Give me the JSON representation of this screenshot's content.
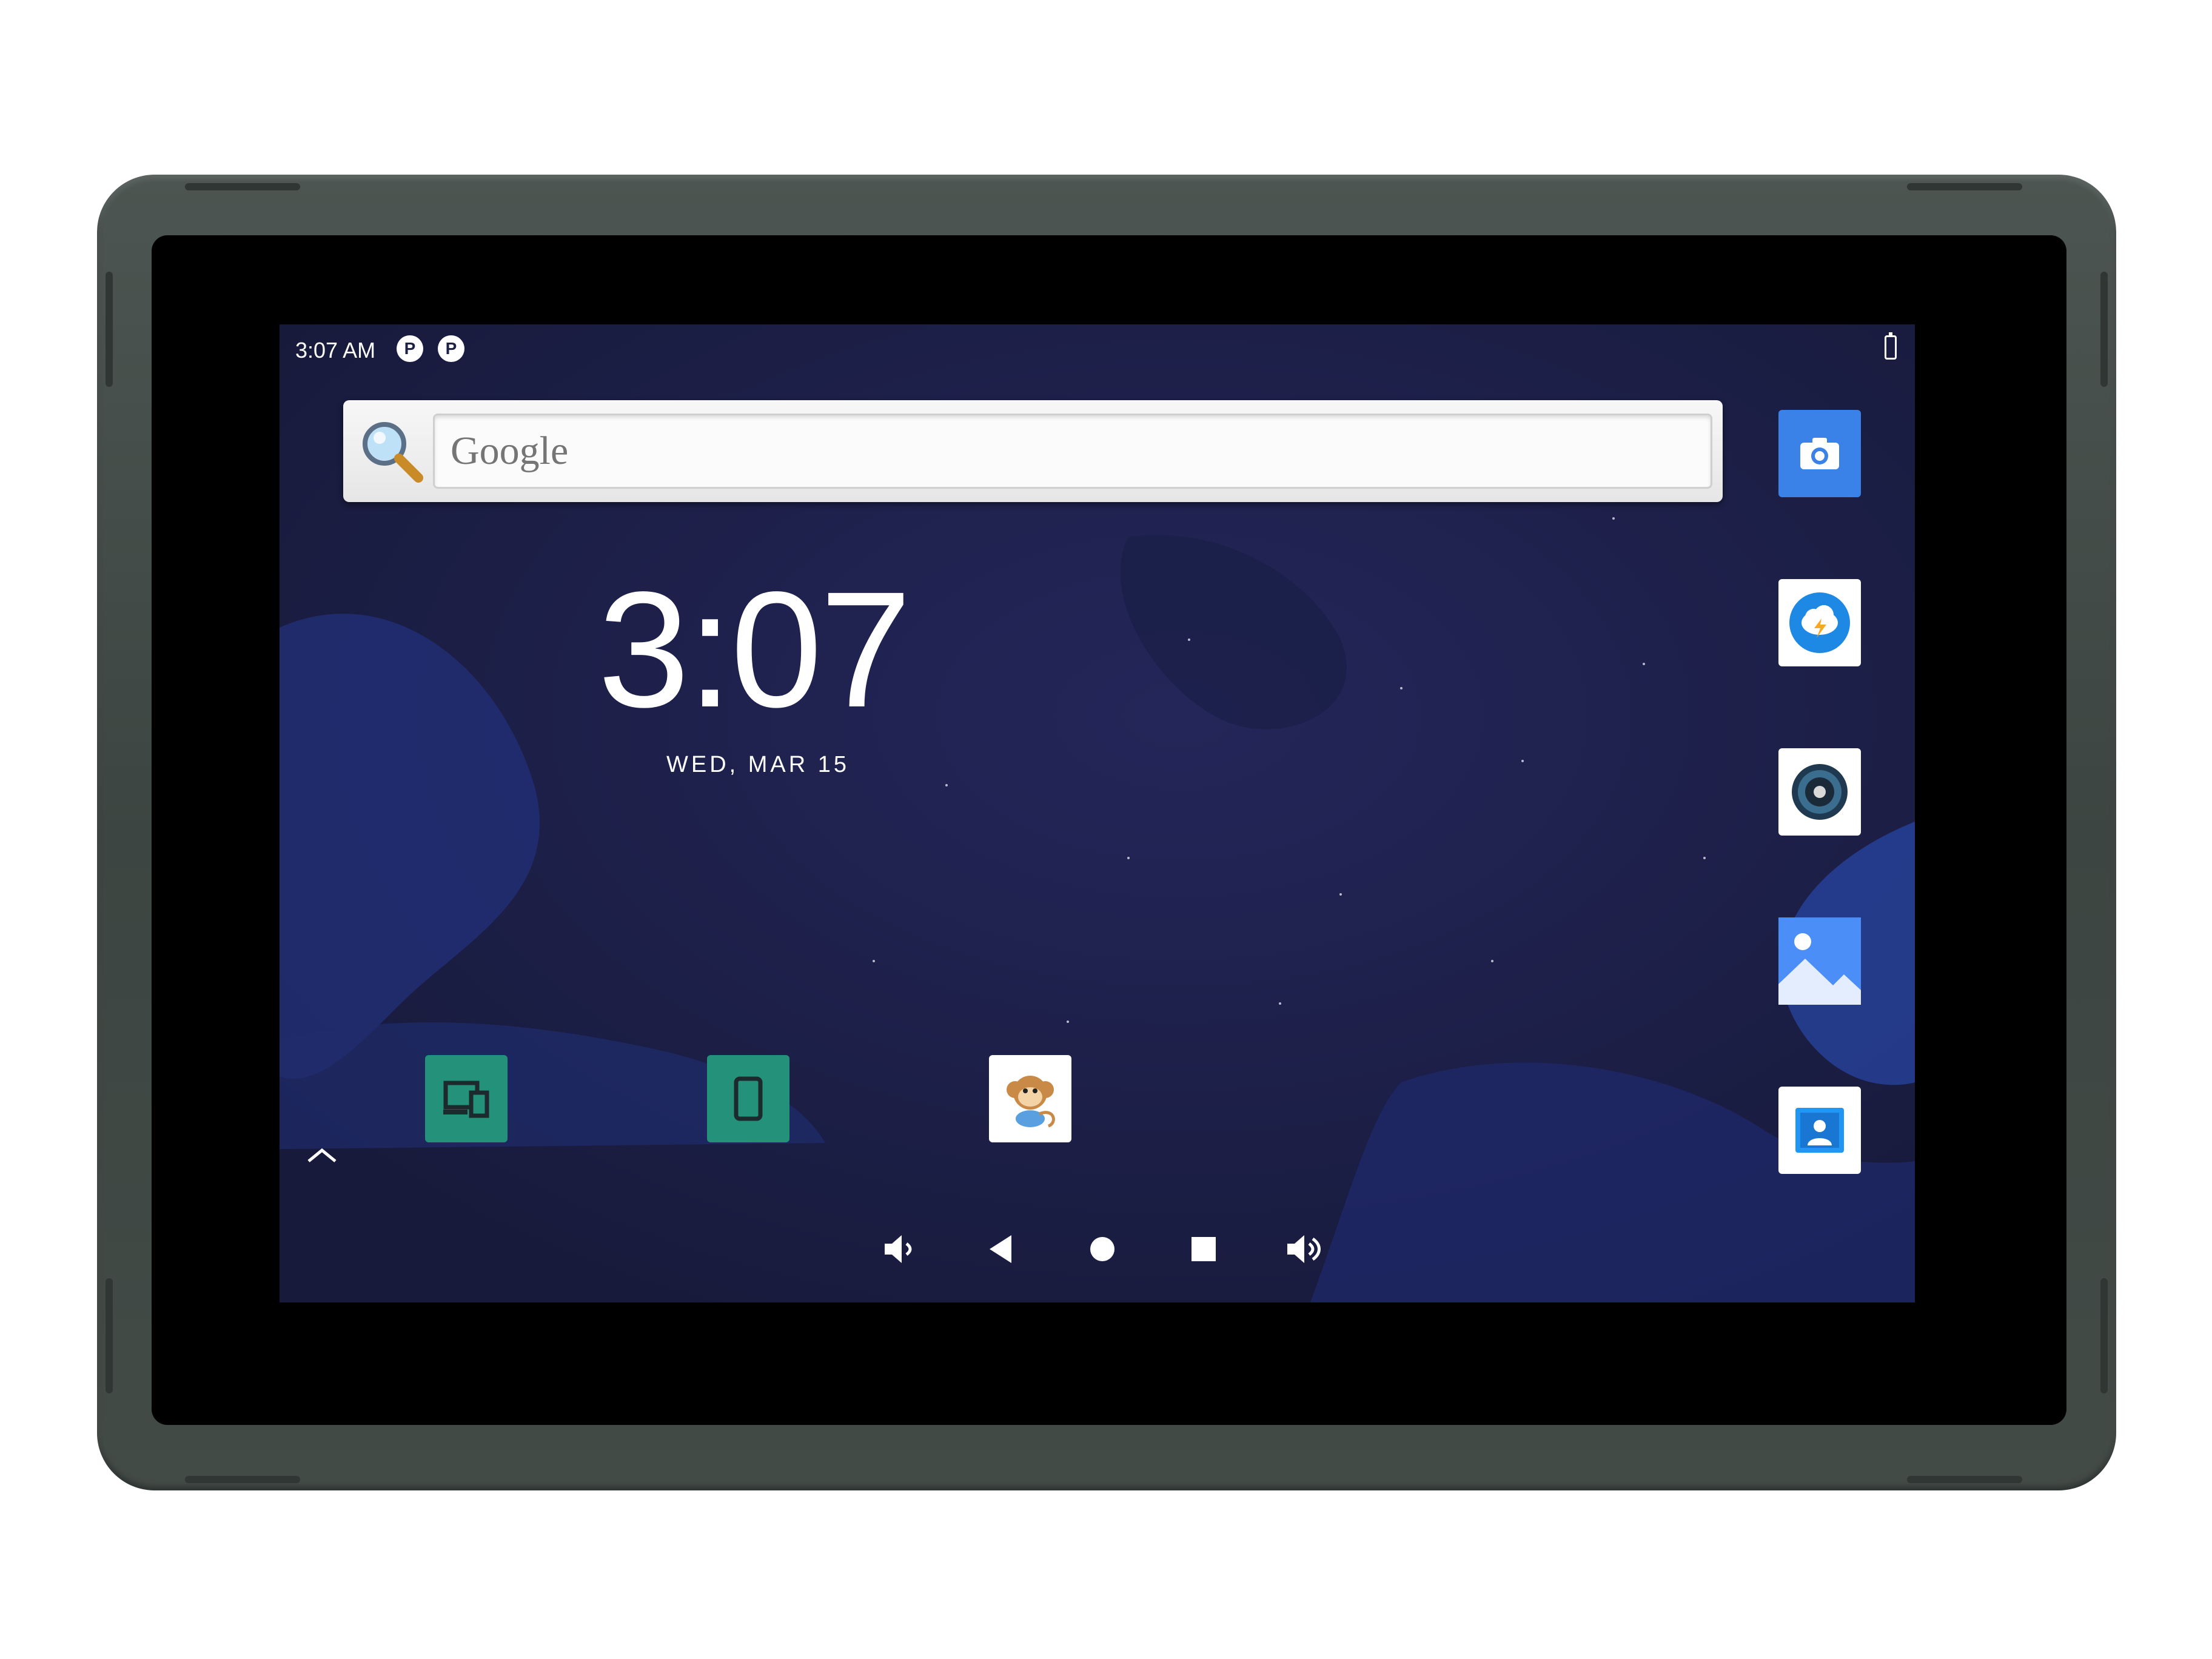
{
  "status_bar": {
    "time": "3:07 AM",
    "notification_icons": [
      "notification-icon",
      "notification-icon"
    ],
    "notification_glyph": "P",
    "battery": "battery-charging-icon"
  },
  "search_widget": {
    "placeholder": "Google",
    "icon": "magnifier-icon"
  },
  "clock": {
    "time": "3:07",
    "date": "WED, MAR 15"
  },
  "home_icons": [
    {
      "name": "devices-app",
      "icon": "devices-icon"
    },
    {
      "name": "tablet-app",
      "icon": "tablet-icon"
    },
    {
      "name": "monkey-app",
      "icon": "monkey-icon"
    }
  ],
  "side_dock": [
    {
      "name": "camera-app",
      "icon": "camera-icon"
    },
    {
      "name": "weather-app",
      "icon": "weather-icon"
    },
    {
      "name": "music-app",
      "icon": "speaker-icon"
    },
    {
      "name": "gallery-app",
      "icon": "gallery-icon"
    },
    {
      "name": "contacts-app",
      "icon": "contacts-icon"
    }
  ],
  "navigation_bar": [
    "volume-down-icon",
    "back-icon",
    "home-icon",
    "recents-icon",
    "volume-up-icon"
  ],
  "colors": {
    "wallpaper": "#1d2146",
    "case": "#434b47",
    "app_green": "#24917b",
    "camera_blue": "#3b82e8"
  }
}
